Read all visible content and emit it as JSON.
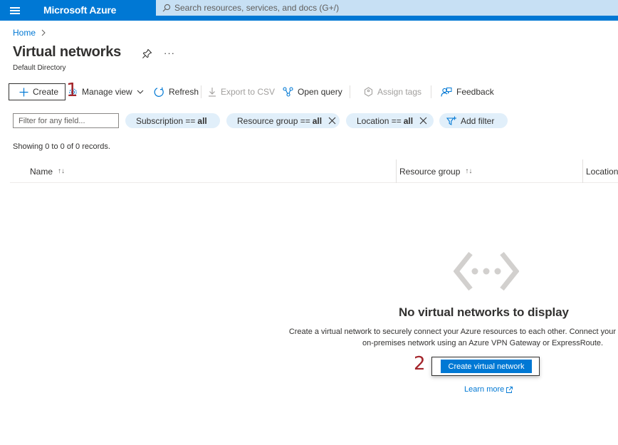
{
  "topbar": {
    "brand": "Microsoft Azure",
    "search_placeholder": "Search resources, services, and docs (G+/)",
    "color": "#0078d4"
  },
  "breadcrumb": {
    "home": "Home"
  },
  "page": {
    "title": "Virtual networks",
    "subtitle": "Default Directory",
    "more": "···"
  },
  "toolbar": {
    "create": "Create",
    "manage_view": "Manage view",
    "refresh": "Refresh",
    "export_csv": "Export to CSV",
    "open_query": "Open query",
    "assign_tags": "Assign tags",
    "feedback": "Feedback"
  },
  "annotations": {
    "step1": "1",
    "step2": "2",
    "color": "#a4262c"
  },
  "filters": {
    "placeholder": "Filter for any field...",
    "subscription": {
      "label": "Subscription ==",
      "value": "all"
    },
    "resource_group": {
      "label": "Resource group ==",
      "value": "all"
    },
    "location": {
      "label": "Location ==",
      "value": "all"
    },
    "add_filter": "Add filter"
  },
  "records_text": "Showing 0 to 0 of 0 records.",
  "table": {
    "columns": [
      {
        "label": "Name",
        "sort": "↑↓"
      },
      {
        "label": "Resource group",
        "sort": "↑↓"
      },
      {
        "label": "Location",
        "sort": ""
      }
    ]
  },
  "empty_state": {
    "icon": "virtual-network-icon",
    "title": "No virtual networks to display",
    "description_line1": "Create a virtual network to securely connect your Azure resources to each other. Connect your",
    "description_line2": "on-premises network using an Azure VPN Gateway or ExpressRoute.",
    "button": "Create virtual network",
    "learn_more": "Learn more"
  }
}
